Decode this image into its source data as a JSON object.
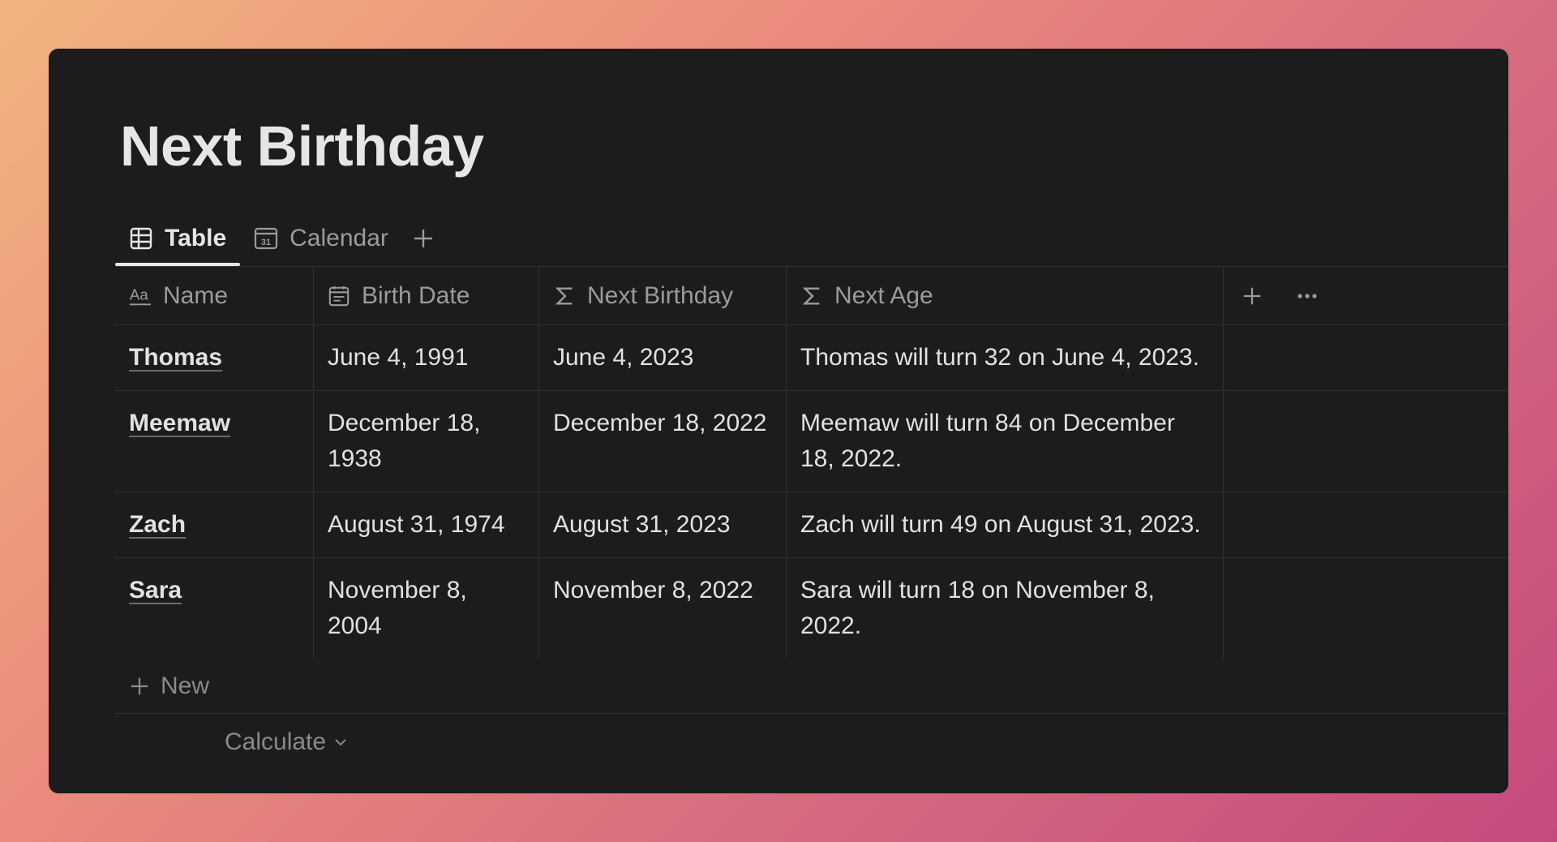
{
  "page": {
    "title": "Next Birthday"
  },
  "tabs": [
    {
      "label": "Table",
      "icon": "table-icon"
    },
    {
      "label": "Calendar",
      "icon": "calendar-icon"
    }
  ],
  "columns": [
    {
      "label": "Name",
      "icon": "text-type-icon"
    },
    {
      "label": "Birth Date",
      "icon": "date-icon"
    },
    {
      "label": "Next Birthday",
      "icon": "formula-icon"
    },
    {
      "label": "Next Age",
      "icon": "formula-icon"
    }
  ],
  "rows": [
    {
      "name": "Thomas",
      "birth": "June 4, 1991",
      "next": "June 4, 2023",
      "age": "Thomas will turn 32 on June 4, 2023."
    },
    {
      "name": "Meemaw",
      "birth": "December 18, 1938",
      "next": "December 18, 2022",
      "age": "Meemaw will turn 84 on December 18, 2022."
    },
    {
      "name": "Zach",
      "birth": "August 31, 1974",
      "next": "August 31, 2023",
      "age": "Zach will turn 49 on August 31, 2023."
    },
    {
      "name": "Sara",
      "birth": "November 8, 2004",
      "next": "November 8, 2022",
      "age": "Sara will turn 18 on November 8, 2022."
    }
  ],
  "footer": {
    "new_label": "New",
    "calculate_label": "Calculate"
  },
  "colors": {
    "background": "#1c1c1c",
    "text": "#e1e1e1",
    "muted": "#9b9b9b",
    "border": "#2f2f2f"
  }
}
